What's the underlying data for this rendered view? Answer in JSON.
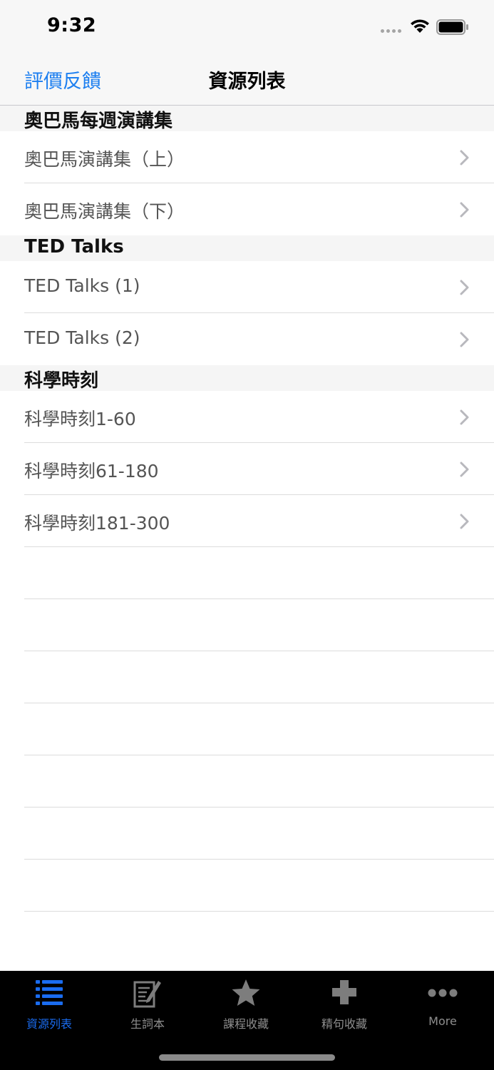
{
  "status_bar": {
    "time": "9:32"
  },
  "nav_bar": {
    "left_button": "評價反饋",
    "title": "資源列表"
  },
  "sections": [
    {
      "header": "奧巴馬每週演講集",
      "items": [
        "奧巴馬演講集（上）",
        "奧巴馬演講集（下）"
      ]
    },
    {
      "header": "TED Talks",
      "items": [
        "TED Talks (1)",
        "TED Talks (2)"
      ]
    },
    {
      "header": "科學時刻",
      "items": [
        "科學時刻1-60",
        "科學時刻61-180",
        "科學時刻181-300"
      ]
    }
  ],
  "tab_bar": {
    "active_index": 0,
    "tabs": [
      {
        "label": "資源列表",
        "icon": "list-icon"
      },
      {
        "label": "生詞本",
        "icon": "notebook-pen-icon"
      },
      {
        "label": "課程收藏",
        "icon": "star-icon"
      },
      {
        "label": "精句收藏",
        "icon": "plus-icon"
      },
      {
        "label": "More",
        "icon": "more-dots-icon"
      }
    ]
  },
  "colors": {
    "accent": "#1d7ff0",
    "tab_active": "#1a6cf0",
    "tab_inactive": "#8e8e8e",
    "tab_bar_bg": "#000000",
    "section_header_bg": "#f5f5f5"
  }
}
